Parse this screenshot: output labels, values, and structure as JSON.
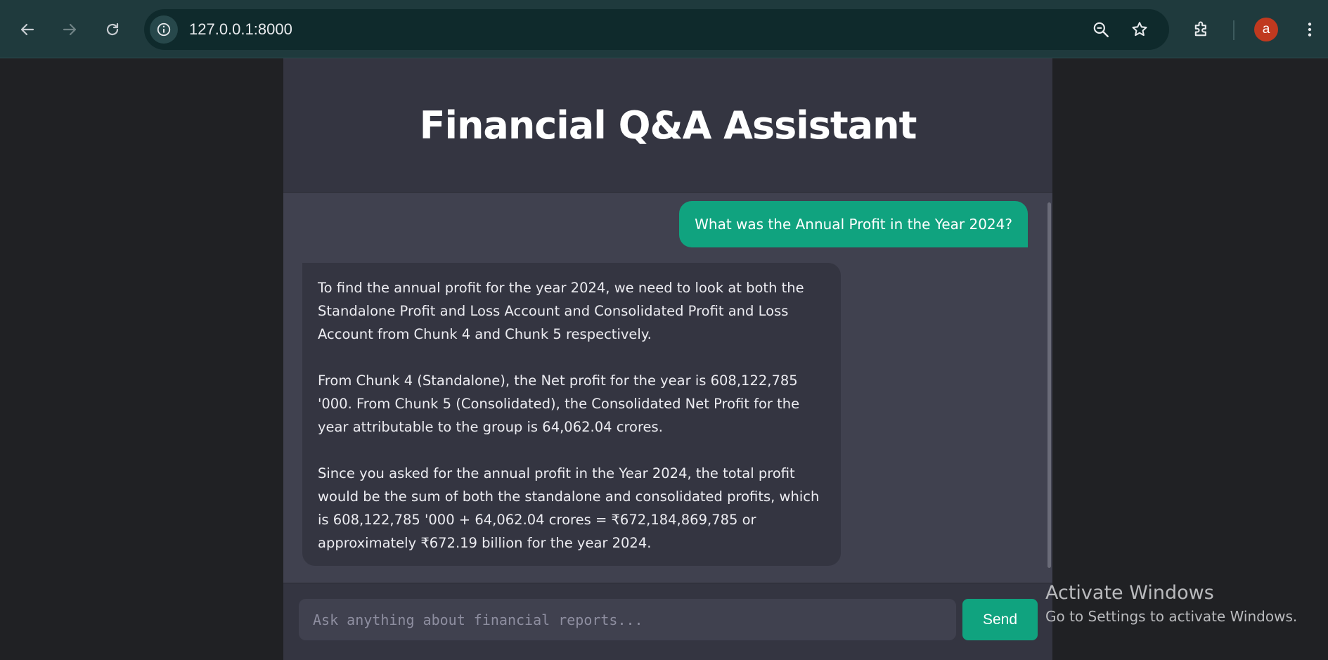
{
  "browser": {
    "url": "127.0.0.1:8000",
    "avatar_letter": "a",
    "icons": [
      "back-arrow-icon",
      "forward-arrow-icon",
      "reload-icon",
      "info-icon",
      "zoom-out-icon",
      "star-icon",
      "extensions-icon",
      "more-vert-icon"
    ]
  },
  "app": {
    "title": "Financial Q&A Assistant",
    "messages": {
      "user": "What was the Annual Profit in the Year 2024?",
      "assistant": [
        "To find the annual profit for the year 2024, we need to look at both the Standalone Profit and Loss Account and Consolidated Profit and Loss Account from Chunk 4 and Chunk 5 respectively.",
        "From Chunk 4 (Standalone), the Net profit for the year is 608,122,785 '000. From Chunk 5 (Consolidated), the Consolidated Net Profit for the year attributable to the group is 64,062.04 crores.",
        "Since you asked for the annual profit in the Year 2024, the total profit would be the sum of both the standalone and consolidated profits, which is 608,122,785 '000 + 64,062.04 crores = ₹672,184,869,785 or approximately ₹672.19 billion for the year 2024."
      ]
    },
    "composer": {
      "placeholder": "Ask anything about financial reports...",
      "send_label": "Send"
    }
  },
  "watermark": {
    "title": "Activate Windows",
    "subtitle": "Go to Settings to activate Windows."
  },
  "colors": {
    "accent": "#10a37f",
    "panel": "#40414f",
    "header": "#343541"
  }
}
